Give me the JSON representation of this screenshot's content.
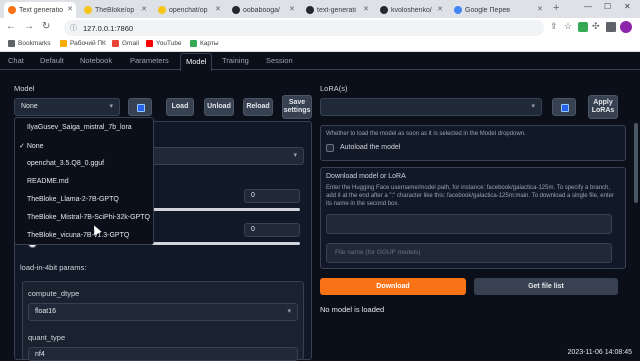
{
  "browser": {
    "tabs": [
      {
        "label": "Text generatio",
        "color": "#f97316",
        "active": true
      },
      {
        "label": "TheBloke/op",
        "color": "#f5c518",
        "active": false
      },
      {
        "label": "openchat/op",
        "color": "#f5c518",
        "active": false
      },
      {
        "label": "oobabooga/",
        "color": "#24292f",
        "active": false
      },
      {
        "label": "text-generati",
        "color": "#24292f",
        "active": false
      },
      {
        "label": "kvoloshenko/",
        "color": "#24292f",
        "active": false
      },
      {
        "label": "Google Перев",
        "color": "#4285f4",
        "active": false
      }
    ],
    "new_tab": "+",
    "url": "127.0.0.1:7860",
    "bookmarks": [
      {
        "label": "Bookmarks",
        "color": "#5f6368"
      },
      {
        "label": "Рабочий ПК",
        "color": "#f9ab00"
      },
      {
        "label": "Gmail",
        "color": "#ea4335"
      },
      {
        "label": "YouTube",
        "color": "#ff0000"
      },
      {
        "label": "Карты",
        "color": "#34a853"
      }
    ]
  },
  "app": {
    "tabs": [
      "Chat",
      "Default",
      "Notebook",
      "Parameters",
      "Model",
      "Training",
      "Session"
    ],
    "active_tab": "Model",
    "model": {
      "label": "Model",
      "selected": "None",
      "load": "Load",
      "unload": "Unload",
      "reload": "Reload",
      "save_settings": "Save settings",
      "options": [
        "IlyaGusev_Saiga_mistral_7b_lora",
        "None",
        "openchat_3.5.Q8_0.gguf",
        "README.md",
        "TheBloke_Llama-2-7B-GPTQ",
        "TheBloke_Mistral-7B-SciPhi-32k-GPTQ",
        "TheBloke_vicuna-7B-v1.3-GPTQ"
      ],
      "checked_option": "✓",
      "slider1_value": "0",
      "slider2_value": "0",
      "load_in_4bit": "load-in-4bit params:",
      "compute_dtype_label": "compute_dtype",
      "compute_dtype_value": "float16",
      "quant_type_label": "quant_type",
      "quant_type_value": "nf4"
    },
    "lora": {
      "label": "LoRA(s)",
      "apply": "Apply LoRAs",
      "autoload_info": "Whether to load the model as soon as it is selected in the Model dropdown.",
      "autoload_label": "Autoload the model",
      "download_title": "Download model or LoRA",
      "download_info": "Enter the Hugging Face username/model path, for instance: facebook/galactica-125m. To specify a branch, add it at the end after a \":\" character like this: facebook/galactica-125m:main. To download a single file, enter its name in the second box.",
      "file_placeholder": "File name (for GGUF models)",
      "download_btn": "Download",
      "get_file_list_btn": "Get file list",
      "status": "No model is loaded"
    }
  },
  "system": {
    "datetime": "2023-11-06  14:08:45"
  }
}
